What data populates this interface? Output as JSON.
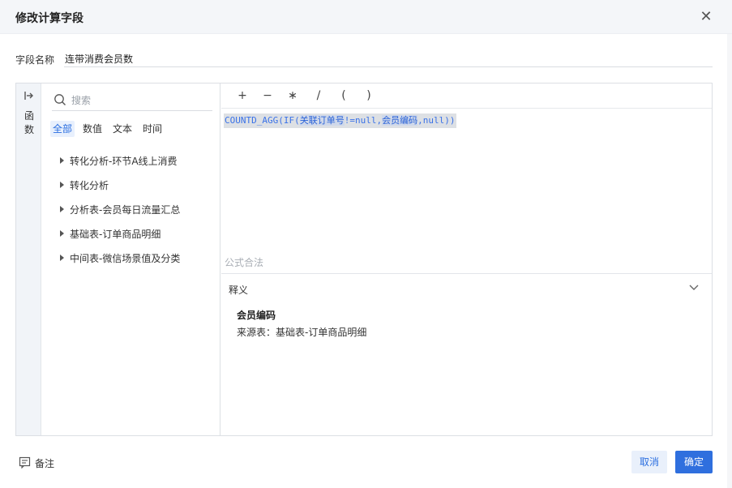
{
  "dialog": {
    "title": "修改计算字段",
    "close_icon": "close-icon"
  },
  "field": {
    "label": "字段名称",
    "value": "连带消费会员数"
  },
  "sidebar": {
    "label": "函数",
    "icon": "collapse-arrow-icon"
  },
  "search": {
    "placeholder": "搜索",
    "icon": "search-icon"
  },
  "tabs": [
    {
      "label": "全部",
      "active": true
    },
    {
      "label": "数值",
      "active": false
    },
    {
      "label": "文本",
      "active": false
    },
    {
      "label": "时间",
      "active": false
    }
  ],
  "tree": [
    {
      "label": "转化分析-环节A线上消费"
    },
    {
      "label": "转化分析"
    },
    {
      "label": "分析表-会员每日流量汇总"
    },
    {
      "label": "基础表-订单商品明细"
    },
    {
      "label": "中间表-微信场景值及分类"
    }
  ],
  "operators": [
    "+",
    "−",
    "∗",
    "/",
    "(",
    ")"
  ],
  "formula": {
    "parts": [
      "COUNTD_AGG(IF(",
      "关联订单号",
      "!=null,",
      "会员编码",
      ",null))"
    ]
  },
  "validity_text": "公式合法",
  "definition": {
    "title": "释义",
    "field_name": "会员编码",
    "source": "来源表：基础表-订单商品明细"
  },
  "footer": {
    "note_label": "备注",
    "cancel_label": "取消",
    "ok_label": "确定"
  },
  "colors": {
    "accent": "#2f6fde",
    "accent_light": "#e9f0fb",
    "header_bg": "#f4f6f9"
  }
}
